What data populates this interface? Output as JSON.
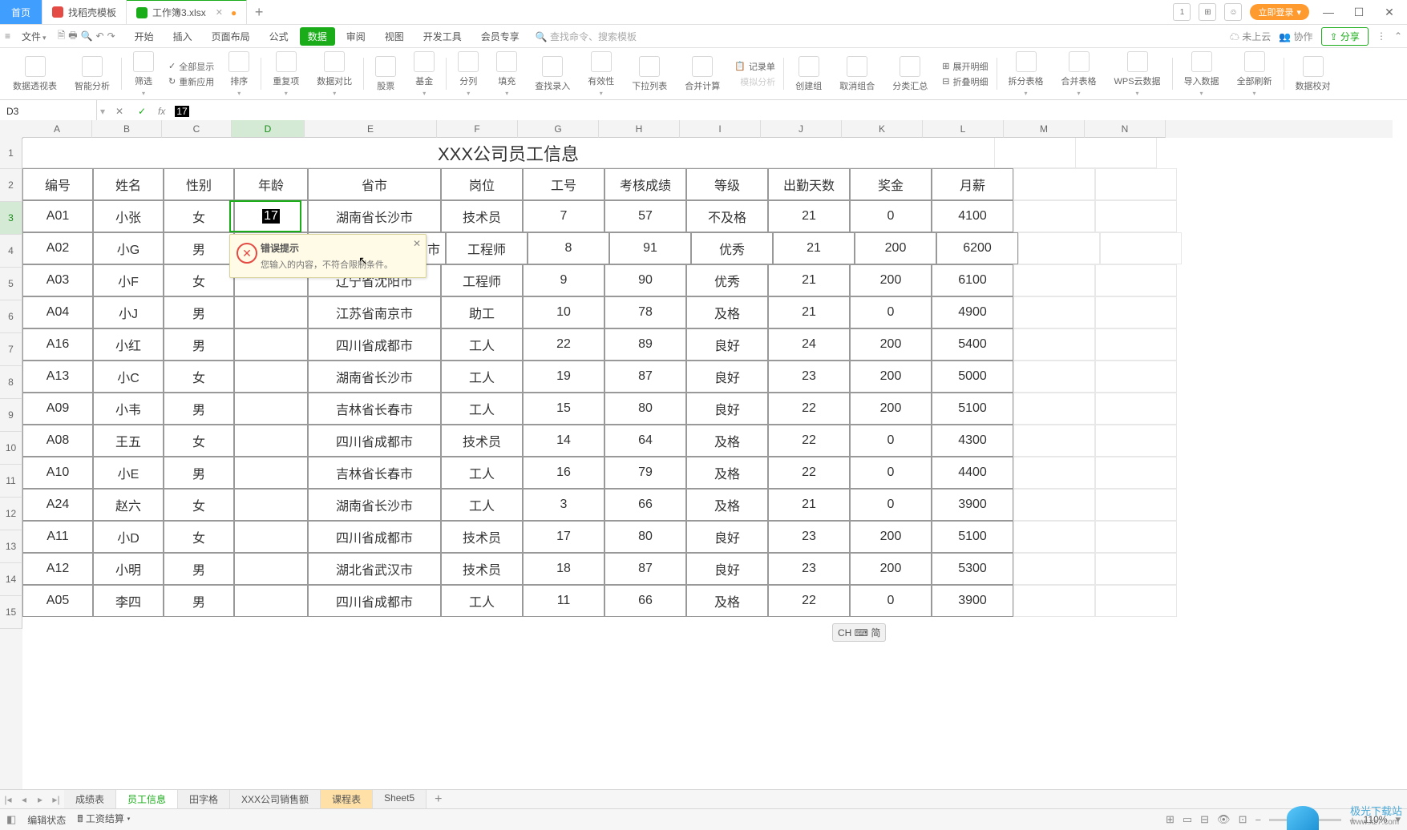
{
  "titlebar": {
    "home_label": "首页",
    "tab1_label": "找稻壳模板",
    "tab2_label": "工作簿3.xlsx",
    "login_label": "立即登录"
  },
  "menubar": {
    "file": "文件",
    "items": [
      "开始",
      "插入",
      "页面布局",
      "公式",
      "数据",
      "审阅",
      "视图",
      "开发工具",
      "会员专享"
    ],
    "active_index": 4,
    "search_placeholder": "查找命令、搜索模板",
    "cloud": "未上云",
    "coop": "协作",
    "share": "分享"
  },
  "ribbon": {
    "groups": [
      "数据透视表",
      "智能分析",
      "筛选",
      "全部显示",
      "重新应用",
      "排序",
      "重复项",
      "数据对比",
      "股票",
      "基金",
      "分列",
      "填充",
      "查找录入",
      "有效性",
      "下拉列表",
      "合并计算",
      "记录单",
      "创建组",
      "取消组合",
      "分类汇总",
      "展开明细",
      "折叠明细",
      "拆分表格",
      "合并表格",
      "WPS云数据",
      "导入数据",
      "全部刷新",
      "数据校对"
    ]
  },
  "fx": {
    "namebox": "D3",
    "formula_value": "17"
  },
  "sheet": {
    "col_letters": [
      "A",
      "B",
      "C",
      "D",
      "E",
      "F",
      "G",
      "H",
      "I",
      "J",
      "K",
      "L",
      "M",
      "N"
    ],
    "title": "XXX公司员工信息",
    "headers": [
      "编号",
      "姓名",
      "性别",
      "年龄",
      "省市",
      "岗位",
      "工号",
      "考核成绩",
      "等级",
      "出勤天数",
      "奖金",
      "月薪"
    ],
    "rows": [
      {
        "n": 3,
        "v": [
          "A01",
          "小张",
          "女",
          "17",
          "湖南省长沙市",
          "技术员",
          "7",
          "57",
          "不及格",
          "21",
          "0",
          "4100"
        ]
      },
      {
        "n": 4,
        "v": [
          "A02",
          "小G",
          "男",
          "",
          "市",
          "工程师",
          "8",
          "91",
          "优秀",
          "21",
          "200",
          "6200"
        ]
      },
      {
        "n": 5,
        "v": [
          "A03",
          "小F",
          "女",
          "",
          "辽宁省沈阳市",
          "工程师",
          "9",
          "90",
          "优秀",
          "21",
          "200",
          "6100"
        ]
      },
      {
        "n": 6,
        "v": [
          "A04",
          "小J",
          "男",
          "",
          "江苏省南京市",
          "助工",
          "10",
          "78",
          "及格",
          "21",
          "0",
          "4900"
        ]
      },
      {
        "n": 7,
        "v": [
          "A16",
          "小红",
          "男",
          "",
          "四川省成都市",
          "工人",
          "22",
          "89",
          "良好",
          "24",
          "200",
          "5400"
        ]
      },
      {
        "n": 8,
        "v": [
          "A13",
          "小C",
          "女",
          "",
          "湖南省长沙市",
          "工人",
          "19",
          "87",
          "良好",
          "23",
          "200",
          "5000"
        ]
      },
      {
        "n": 9,
        "v": [
          "A09",
          "小韦",
          "男",
          "",
          "吉林省长春市",
          "工人",
          "15",
          "80",
          "良好",
          "22",
          "200",
          "5100"
        ]
      },
      {
        "n": 10,
        "v": [
          "A08",
          "王五",
          "女",
          "",
          "四川省成都市",
          "技术员",
          "14",
          "64",
          "及格",
          "22",
          "0",
          "4300"
        ]
      },
      {
        "n": 11,
        "v": [
          "A10",
          "小E",
          "男",
          "",
          "吉林省长春市",
          "工人",
          "16",
          "79",
          "及格",
          "22",
          "0",
          "4400"
        ]
      },
      {
        "n": 12,
        "v": [
          "A24",
          "赵六",
          "女",
          "",
          "湖南省长沙市",
          "工人",
          "3",
          "66",
          "及格",
          "21",
          "0",
          "3900"
        ]
      },
      {
        "n": 13,
        "v": [
          "A11",
          "小D",
          "女",
          "",
          "四川省成都市",
          "技术员",
          "17",
          "80",
          "良好",
          "23",
          "200",
          "5100"
        ]
      },
      {
        "n": 14,
        "v": [
          "A12",
          "小明",
          "男",
          "",
          "湖北省武汉市",
          "技术员",
          "18",
          "87",
          "良好",
          "23",
          "200",
          "5300"
        ]
      },
      {
        "n": 15,
        "v": [
          "A05",
          "李四",
          "男",
          "",
          "四川省成都市",
          "工人",
          "11",
          "66",
          "及格",
          "22",
          "0",
          "3900"
        ]
      }
    ],
    "active_cell": "D3",
    "editing_value": "17"
  },
  "error_tip": {
    "title": "错误提示",
    "message": "您输入的内容，不符合限制条件。"
  },
  "ime_badge": "CH ⌨ 简",
  "sheet_tabs": {
    "tabs": [
      "成绩表",
      "员工信息",
      "田字格",
      "XXX公司销售额",
      "课程表",
      "Sheet5"
    ],
    "active_index": 1,
    "highlight_index": 4
  },
  "statusbar": {
    "state": "编辑状态",
    "pay": "工资结算",
    "zoom": "110%"
  },
  "watermark": "极光下载站",
  "watermark_url": "www.xz7.com"
}
